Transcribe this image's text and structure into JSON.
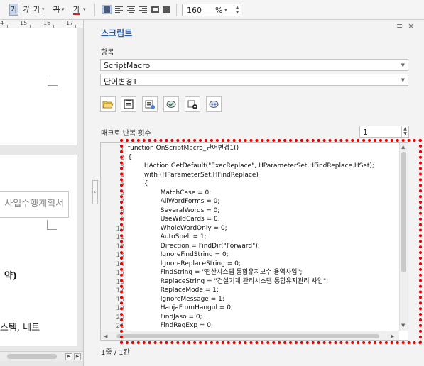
{
  "toolbar": {
    "bold_label": "가",
    "italic_label": "가",
    "underline_label": "가",
    "strike_label": "가",
    "fontcolor_label": "가",
    "dropdown_glyph": "▾",
    "zoom_value": "160",
    "zoom_unit": "%"
  },
  "ruler": {
    "ticks": [
      "4",
      "15",
      "16",
      "17"
    ]
  },
  "document": {
    "box_text": "사업수행계획서",
    "bold_text": "약)",
    "body_text": "스템, 네트"
  },
  "panel": {
    "title": "스크립트",
    "menu_glyph": "≡",
    "close_glyph": "×",
    "item_label": "항목",
    "macro_select": "ScriptMacro",
    "function_select": "단어변경1",
    "repeat_label": "매크로 반복 횟수",
    "repeat_value": "1",
    "status": "1줄 / 1칸"
  },
  "icons": [
    "folder-open-icon",
    "save-icon",
    "run-macro-icon",
    "check-macro-icon",
    "add-macro-icon",
    "record-macro-icon"
  ],
  "code": {
    "line_numbers": [
      "1",
      "2",
      "3",
      "4",
      "5",
      "6",
      "7",
      "8",
      "9",
      "10",
      "11",
      "12",
      "13",
      "14",
      "15",
      "16",
      "17",
      "18",
      "19",
      "20",
      "21"
    ],
    "lines": [
      "function OnScriptMacro_단어변경1()",
      "{",
      "        HAction.GetDefault(\"ExecReplace\", HParameterSet.HFindReplace.HSet);",
      "        with (HParameterSet.HFindReplace)",
      "        {",
      "                MatchCase = 0;",
      "                AllWordForms = 0;",
      "                SeveralWords = 0;",
      "                UseWildCards = 0;",
      "                WholeWordOnly = 0;",
      "                AutoSpell = 1;",
      "                Direction = FindDir(\"Forward\");",
      "                IgnoreFindString = 0;",
      "                IgnoreReplaceString = 0;",
      "                FindString = \"전산시스템 통합유지보수 용역사업\";",
      "                ReplaceString = \"건설기계 관리시스템 통합유지관리 사업\";",
      "                ReplaceMode = 1;",
      "                IgnoreMessage = 1;",
      "                HanjaFromHangul = 0;",
      "                FindJaso = 0;",
      "                FindRegExp = 0;"
    ]
  },
  "colors": {
    "accent": "#2a5ca8",
    "highlight": "#e00000"
  }
}
